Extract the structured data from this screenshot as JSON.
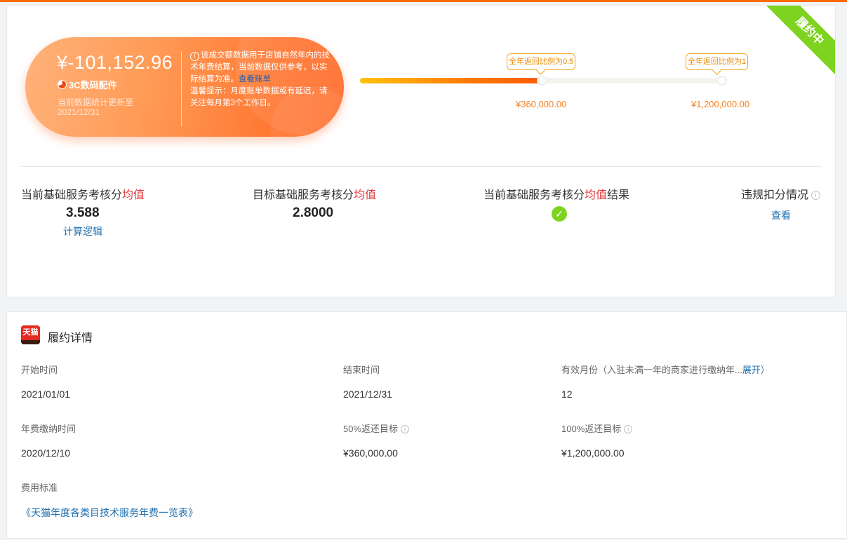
{
  "status_ribbon": "履约中",
  "summary": {
    "amount": "¥-101,152.96",
    "category": "3C数码配件",
    "update_label": "当前数据统计更新至",
    "update_date": "2021/12/31",
    "note_pre": "该成交额数据用于店铺自然年内的技术年费结算，当前数据仅供参考，以实际结算为准。",
    "note_link": "查看账单",
    "note_post": "温馨提示：月度账单数据或有延迟，请关注每月第3个工作日。"
  },
  "progress": {
    "fraction": 0.5,
    "milestones": [
      {
        "tag": "全年返回比例为0.5",
        "amount": "¥360,000.00"
      },
      {
        "tag": "全年返回比例为1",
        "amount": "¥1,200,000.00"
      }
    ]
  },
  "stats": {
    "current_title_pre": "当前基础服务考核分",
    "current_title_red": "均值",
    "current_value": "3.588",
    "calc_link": "计算逻辑",
    "target_title_pre": "目标基础服务考核分",
    "target_title_red": "均值",
    "target_value": "2.8000",
    "result_title_pre": "当前基础服务考核分",
    "result_title_red": "均值",
    "result_title_post": "结果",
    "violation_title": "违规扣分情况",
    "view_link": "查看"
  },
  "details": {
    "logo_text": "天猫",
    "title": "履约详情",
    "start_label": "开始时间",
    "start_value": "2021/01/01",
    "end_label": "结束时间",
    "end_value": "2021/12/31",
    "months_label": "有效月份（入驻未满一年的商家进行缴纳年...",
    "months_expand": "展开",
    "months_close": "）",
    "months_value": "12",
    "fee_time_label": "年费缴纳时间",
    "fee_time_value": "2020/12/10",
    "half_label": "50%返还目标",
    "half_value": "¥360,000.00",
    "full_label": "100%返还目标",
    "full_value": "¥1,200,000.00",
    "standard_label": "费用标准",
    "standard_link": "《天猫年度各类目技术服务年费一览表》"
  }
}
